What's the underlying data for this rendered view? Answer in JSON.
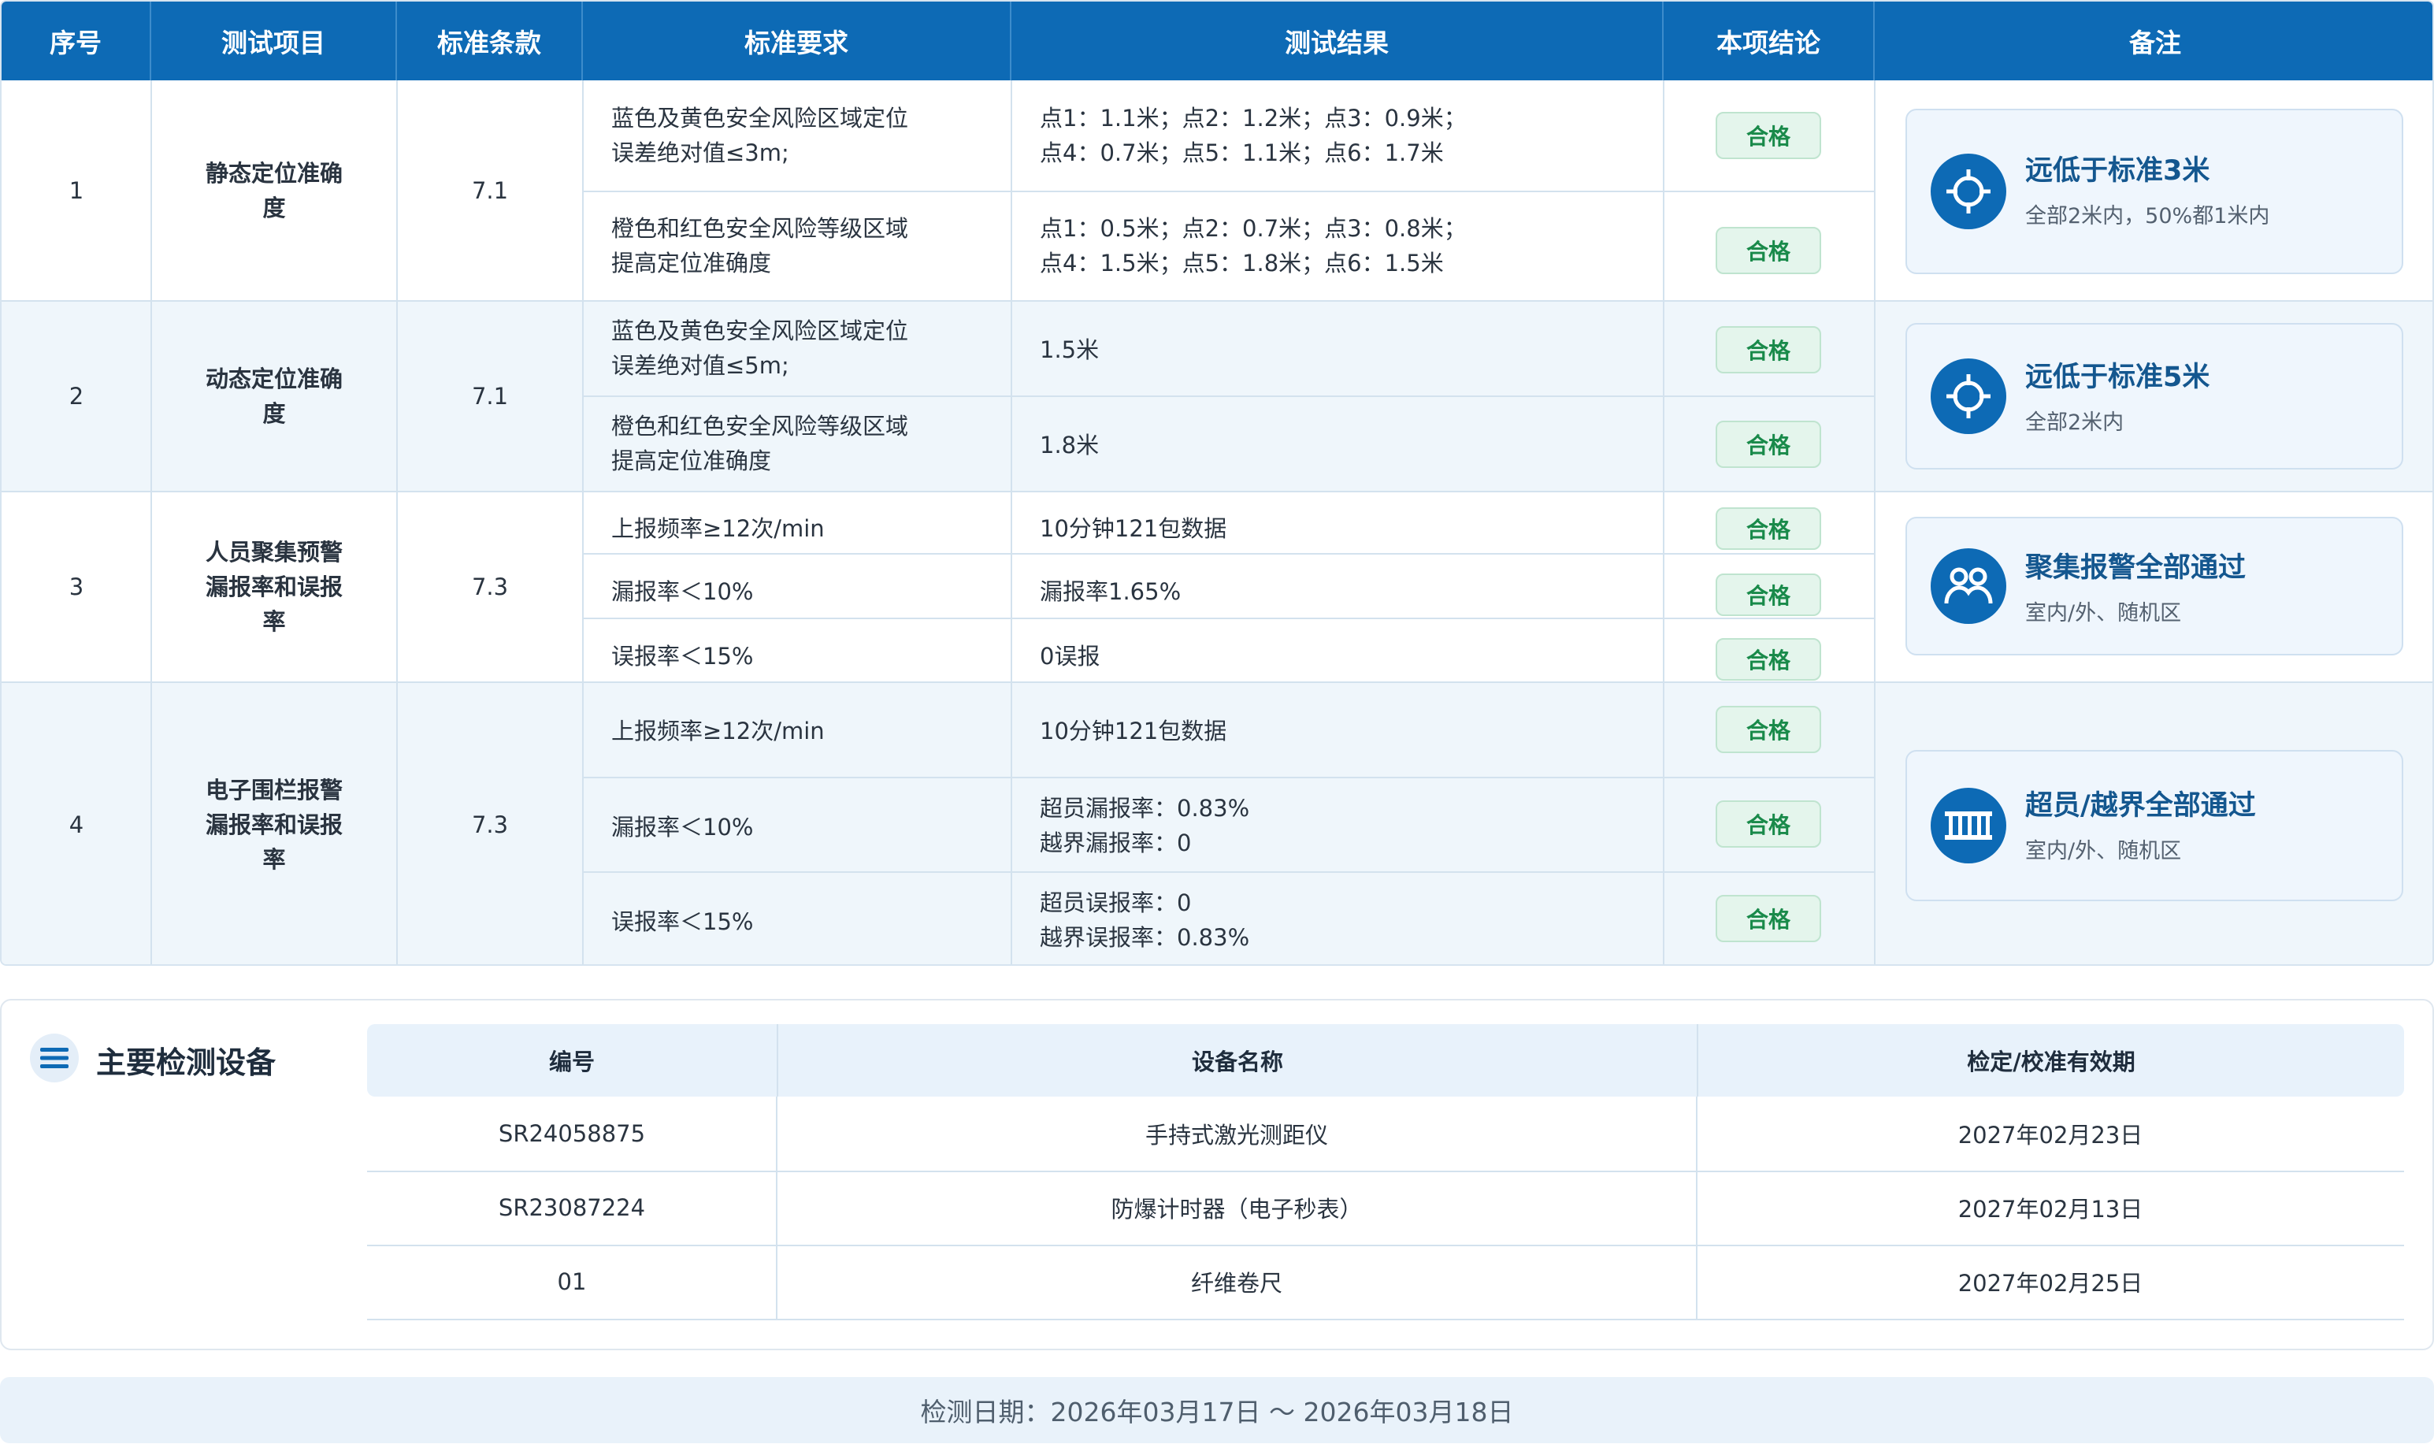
{
  "headers": [
    "序号",
    "测试项目",
    "标准条款",
    "标准要求",
    "测试结果",
    "本项结论",
    "备注"
  ],
  "rows": [
    {
      "no": "1",
      "item": "静态定位准确度",
      "clause": "7.1",
      "subs": [
        {
          "req": "蓝色及黄色安全风险区域定位误差绝对值≤3m;",
          "res_line1": "点1：1.1米；点2：1.2米；点3：0.9米；",
          "res_line2": "点4：0.7米；点5：1.1米；点6：1.7米",
          "conclusion": "合格"
        },
        {
          "req": "橙色和红色安全风险等级区域提高定位准确度",
          "res_line1": "点1：0.5米；点2：0.7米；点3：0.8米；",
          "res_line2": "点4：1.5米；点5：1.8米；点6：1.5米",
          "conclusion": "合格"
        }
      ],
      "note": {
        "icon": "crosshair-icon",
        "title": "远低于标准3米",
        "sub": "全部2米内，50%都1米内"
      }
    },
    {
      "no": "2",
      "item": "动态定位准确度",
      "clause": "7.1",
      "subs": [
        {
          "req": "蓝色及黄色安全风险区域定位误差绝对值≤5m;",
          "res": "1.5米",
          "conclusion": "合格"
        },
        {
          "req": "橙色和红色安全风险等级区域提高定位准确度",
          "res": "1.8米",
          "conclusion": "合格"
        }
      ],
      "note": {
        "icon": "crosshair-icon",
        "title": "远低于标准5米",
        "sub": "全部2米内"
      }
    },
    {
      "no": "3",
      "item": "人员聚集预警漏报率和误报率",
      "clause": "7.3",
      "subs": [
        {
          "req": "上报频率≥12次/min",
          "res": "10分钟121包数据",
          "conclusion": "合格"
        },
        {
          "req": "漏报率＜10%",
          "res": "漏报率1.65%",
          "conclusion": "合格"
        },
        {
          "req": "误报率＜15%",
          "res": "0误报",
          "conclusion": "合格"
        }
      ],
      "note": {
        "icon": "people-icon",
        "title": "聚集报警全部通过",
        "sub": "室内/外、随机区"
      }
    },
    {
      "no": "4",
      "item": "电子围栏报警漏报率和误报率",
      "clause": "7.3",
      "subs": [
        {
          "req": "上报频率≥12次/min",
          "res": "10分钟121包数据",
          "conclusion": "合格"
        },
        {
          "req": "漏报率＜10%",
          "res_line1": "超员漏报率：0.83%",
          "res_line2": "越界漏报率：0",
          "conclusion": "合格"
        },
        {
          "req": "误报率＜15%",
          "res_line1": "超员误报率：0",
          "res_line2": "越界误报率：0.83%",
          "conclusion": "合格"
        }
      ],
      "note": {
        "icon": "fence-icon",
        "title": "超员/越界全部通过",
        "sub": "室内/外、随机区"
      }
    }
  ],
  "equipment": {
    "title": "主要检测设备",
    "headers": [
      "编号",
      "设备名称",
      "检定/校准有效期"
    ],
    "rows": [
      [
        "SR24058875",
        "手持式激光测距仪",
        "2027年02月23日"
      ],
      [
        "SR23087224",
        "防爆计时器（电子秒表）",
        "2027年02月13日"
      ],
      [
        "01",
        "纤维卷尺",
        "2027年02月25日"
      ]
    ]
  },
  "footer": "检测日期：2026年03月17日 ～ 2026年03月18日",
  "colors": {
    "header": "#0d6ab5",
    "pass_text": "#198a4a",
    "pass_bg": "#e4f5ec",
    "alt_row": "#eff6fb"
  }
}
